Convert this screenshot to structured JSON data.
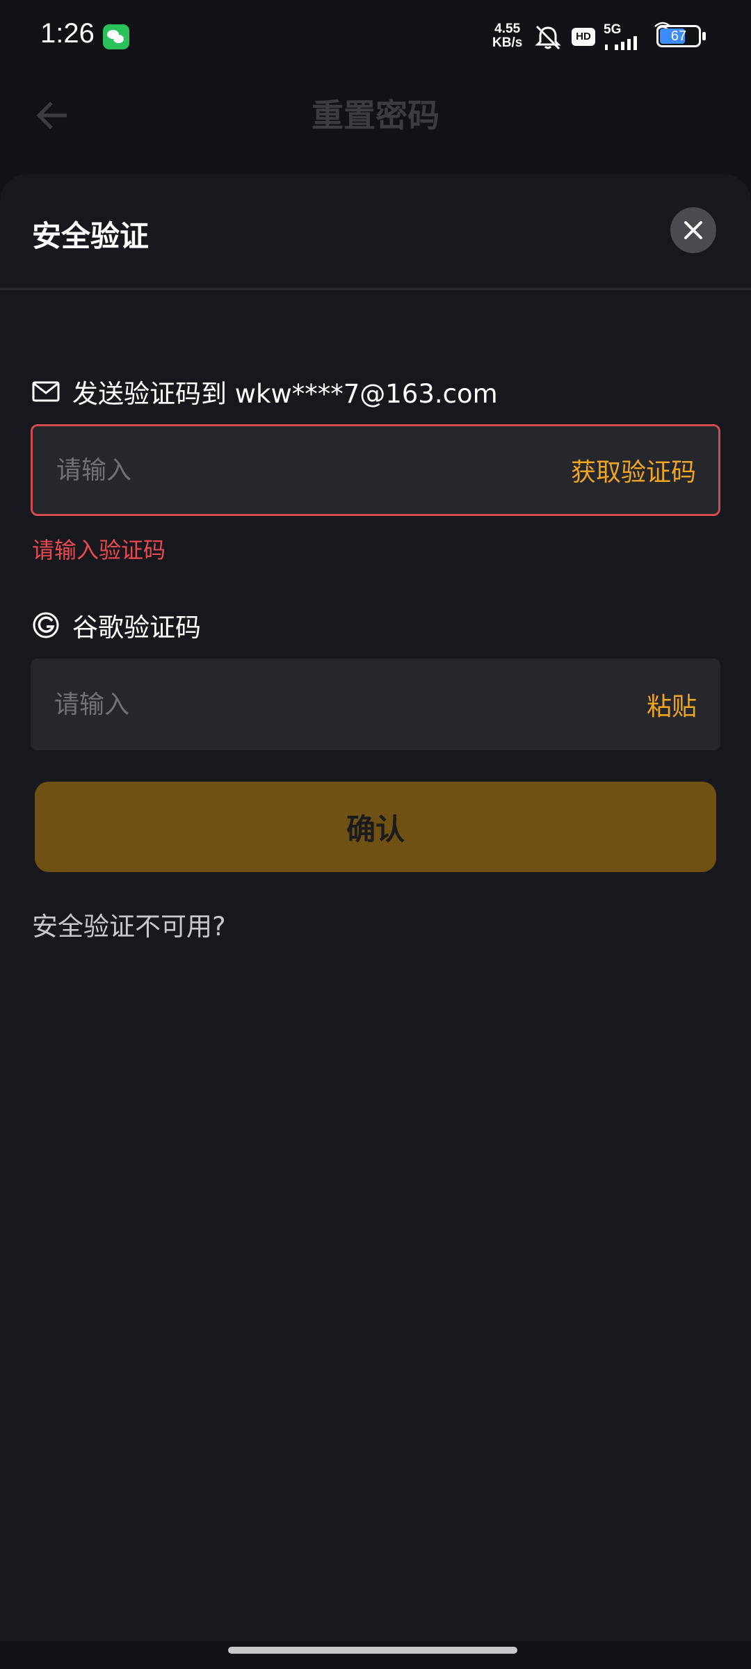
{
  "status_bar": {
    "time": "1:26",
    "net_speed_value": "4.55",
    "net_speed_unit": "KB/s",
    "hd": "HD",
    "network": "5G",
    "battery": "67",
    "battery_level": 0.67
  },
  "nav": {
    "title": "重置密码"
  },
  "sheet": {
    "title": "安全验证",
    "email_label": "发送验证码到 wkw****7@163.com",
    "email_placeholder": "请输入",
    "get_code": "获取验证码",
    "error": "请输入验证码",
    "google_label": "谷歌验证码",
    "google_placeholder": "请输入",
    "paste": "粘贴",
    "confirm": "确认",
    "unavailable": "安全验证不可用?"
  },
  "colors": {
    "accent": "#f0a521",
    "error": "#e8494f",
    "button": "#6f5114",
    "background": "#17181d"
  }
}
